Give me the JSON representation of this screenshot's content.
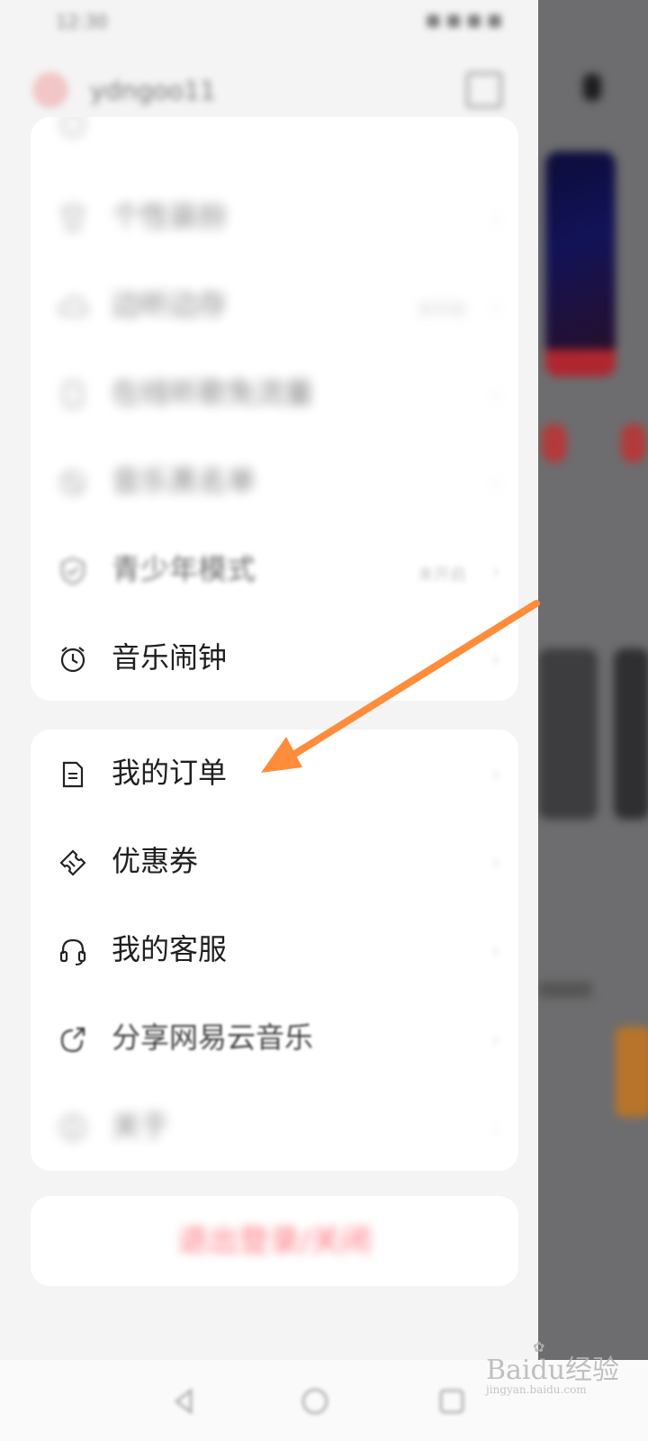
{
  "colors": {
    "accent_arrow": "#ff8c3a",
    "logout_red": "#ff3b4a",
    "overlay": "#6d6d6f"
  },
  "status_bar": {
    "time": "12:30",
    "right": "■ ■ ■ ■"
  },
  "user": {
    "username": "ydngoo11"
  },
  "card1": {
    "items": [
      {
        "label": "个性装扮",
        "icon": "shirt-icon",
        "value": ""
      },
      {
        "label": "边听边存",
        "icon": "cloud-icon",
        "value": "未开启"
      },
      {
        "label": "在线听歌免流量",
        "icon": "phone-icon",
        "value": ""
      },
      {
        "label": "音乐黑名单",
        "icon": "block-icon",
        "value": ""
      },
      {
        "label": "青少年模式",
        "icon": "shield-icon",
        "value": "未开启"
      },
      {
        "label": "音乐闹钟",
        "icon": "alarm-icon",
        "value": ""
      }
    ]
  },
  "card2": {
    "items": [
      {
        "label": "我的订单",
        "icon": "document-icon"
      },
      {
        "label": "优惠券",
        "icon": "ticket-icon"
      },
      {
        "label": "我的客服",
        "icon": "headset-icon"
      },
      {
        "label": "分享网易云音乐",
        "icon": "share-icon"
      },
      {
        "label": "关于",
        "icon": "info-icon"
      }
    ]
  },
  "logout": {
    "label": "退出登录/关闭"
  },
  "chevron": "›",
  "watermark": {
    "text": "Baidu经验",
    "sub": "jingyan.baidu.com"
  }
}
